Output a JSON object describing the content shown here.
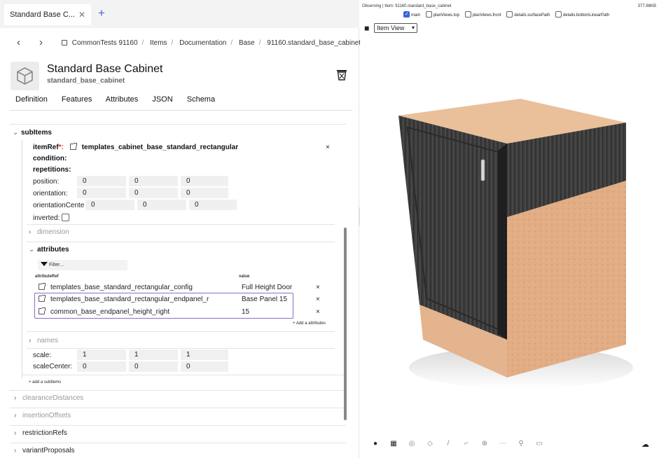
{
  "tab": {
    "title": "Standard Base C...",
    "close": "✕",
    "new": "+"
  },
  "nav": {
    "back": "‹",
    "forward": "›"
  },
  "breadcrumb": [
    "CommonTests 91160",
    "Items",
    "Documentation",
    "Base",
    "91160.standard_base_cabinet"
  ],
  "header": {
    "title": "Standard Base Cabinet",
    "subtitle": "standard_base_cabinet"
  },
  "doc_tabs": [
    "Definition",
    "Features",
    "Attributes",
    "JSON",
    "Schema"
  ],
  "tree": {
    "subitems_label": "subItems",
    "itemref_label": "itemRef",
    "itemref_required": "*:",
    "itemref_value": "templates_cabinet_base_standard_rectangular",
    "condition_label": "condition:",
    "repetitions_label": "repetitions:",
    "position_label": "position:",
    "position": [
      "0",
      "0",
      "0"
    ],
    "orientation_label": "orientation:",
    "orientation": [
      "0",
      "0",
      "0"
    ],
    "orientation_center_label": "orientationCente",
    "orientation_center": [
      "0",
      "0",
      "0"
    ],
    "inverted_label": "inverted:",
    "dimension_label": "dimension",
    "attributes_label": "attributes",
    "filter_placeholder": "Filter...",
    "col_attributeref": "attributeRef",
    "col_value": "value",
    "attribute_rows": [
      {
        "ref": "templates_base_standard_rectangular_config",
        "value": "Full Height Door"
      },
      {
        "ref": "templates_base_standard_rectangular_endpanel_r",
        "value": "Base Panel 15"
      },
      {
        "ref": "common_base_endpanel_height_right",
        "value": "15"
      }
    ],
    "add_attribute": "+ Add a attributes",
    "names_label": "names",
    "scale_label": "scale:",
    "scale": [
      "1",
      "1",
      "1"
    ],
    "scale_center_label": "scaleCenter:",
    "scale_center": [
      "0",
      "0",
      "0"
    ],
    "add_subitem": "+ add a subItems",
    "clearance_label": "clearanceDistances",
    "insertion_label": "insertionOffsets",
    "restriction_label": "restrictionRefs",
    "variant_label": "variantProposals",
    "remove": "×"
  },
  "viewer": {
    "observing": "Observing | Item: 91160.standard_base_cabinet",
    "size": "377.88KB",
    "layers": [
      {
        "label": "main",
        "checked": true
      },
      {
        "label": "planViews.top",
        "checked": false
      },
      {
        "label": "planViews.front",
        "checked": false
      },
      {
        "label": "details.surfacePath",
        "checked": false
      },
      {
        "label": "details.bottomLinearPath",
        "checked": false
      }
    ],
    "view_select": "Item View"
  },
  "colors": {
    "accent": "#4a63d6",
    "selection": "#8e6cc6",
    "wood": "#e6b389",
    "door": "#3a3a3a"
  }
}
